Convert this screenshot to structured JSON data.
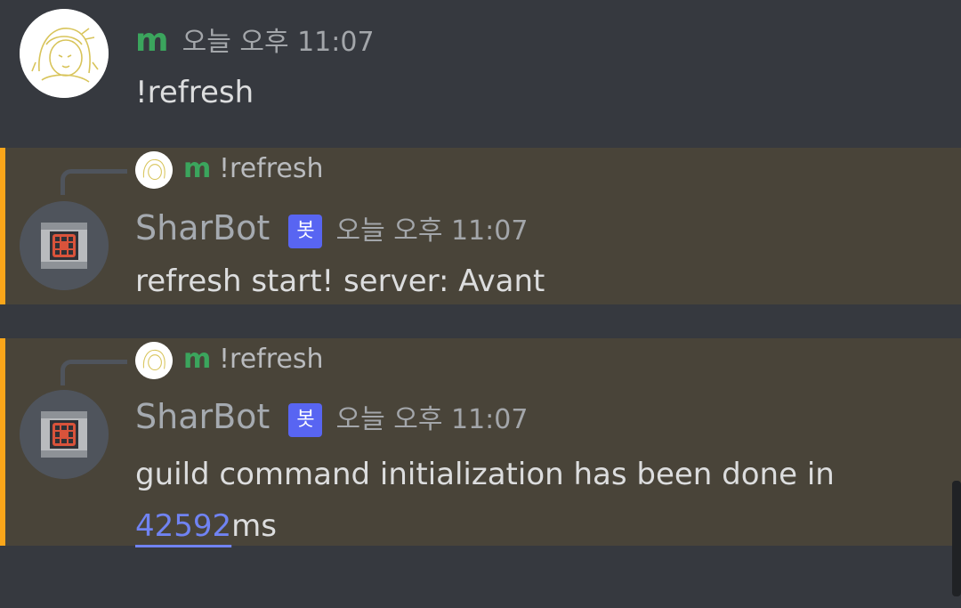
{
  "messages": [
    {
      "author": "m",
      "timestamp": "오늘 오후 11:07",
      "content": "!refresh"
    },
    {
      "reply": {
        "author": "m",
        "content": "!refresh"
      },
      "author": "SharBot",
      "bot_tag": "봇",
      "timestamp": "오늘 오후 11:07",
      "content": "refresh start! server: Avant"
    },
    {
      "reply": {
        "author": "m",
        "content": "!refresh"
      },
      "author": "SharBot",
      "bot_tag": "봇",
      "timestamp": "오늘 오후 11:07",
      "content_prefix": "guild command initialization has been done in",
      "content_link": "42592",
      "content_suffix": "ms"
    }
  ],
  "colors": {
    "background": "#36393f",
    "mention_background": "#494439",
    "mention_bar": "#faa61a",
    "username": "#3ba55d",
    "link": "#7083f2",
    "bot_tag": "#5865f2"
  },
  "icons": {
    "user_avatar": "anime-sketch-avatar",
    "bot_avatar": "robot-face-avatar"
  }
}
